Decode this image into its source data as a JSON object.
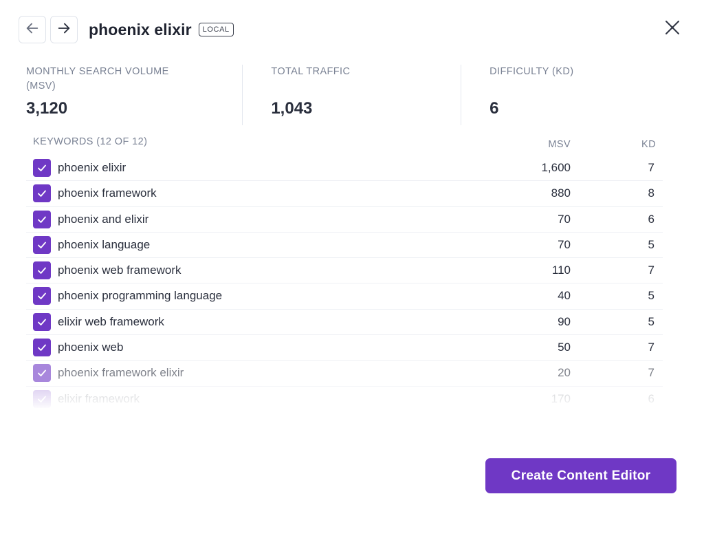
{
  "header": {
    "title": "phoenix elixir",
    "badge": "LOCAL",
    "back_icon": "arrow-left-icon",
    "forward_icon": "arrow-right-icon",
    "close_icon": "close-icon"
  },
  "stats": [
    {
      "label": "MONTHLY SEARCH VOLUME (MSV)",
      "value": "3,120"
    },
    {
      "label": "TOTAL TRAFFIC",
      "value": "1,043"
    },
    {
      "label": "DIFFICULTY (KD)",
      "value": "6"
    }
  ],
  "keywords": {
    "title": "KEYWORDS (12 OF 12)",
    "columns": {
      "msv": "MSV",
      "kd": "KD"
    },
    "rows": [
      {
        "keyword": "phoenix elixir",
        "msv": "1,600",
        "kd": "7",
        "checked": true
      },
      {
        "keyword": "phoenix framework",
        "msv": "880",
        "kd": "8",
        "checked": true
      },
      {
        "keyword": "phoenix and elixir",
        "msv": "70",
        "kd": "6",
        "checked": true
      },
      {
        "keyword": "phoenix language",
        "msv": "70",
        "kd": "5",
        "checked": true
      },
      {
        "keyword": "phoenix web framework",
        "msv": "110",
        "kd": "7",
        "checked": true
      },
      {
        "keyword": "phoenix programming language",
        "msv": "40",
        "kd": "5",
        "checked": true
      },
      {
        "keyword": "elixir web framework",
        "msv": "90",
        "kd": "5",
        "checked": true
      },
      {
        "keyword": "phoenix web",
        "msv": "50",
        "kd": "7",
        "checked": true
      },
      {
        "keyword": "phoenix framework elixir",
        "msv": "20",
        "kd": "7",
        "checked": true
      },
      {
        "keyword": "elixir framework",
        "msv": "170",
        "kd": "6",
        "checked": true
      }
    ]
  },
  "colors": {
    "accent": "#6f38c5",
    "text": "#2a2f3d",
    "muted": "#7a8294"
  },
  "actions": {
    "create_label": "Create Content Editor"
  }
}
